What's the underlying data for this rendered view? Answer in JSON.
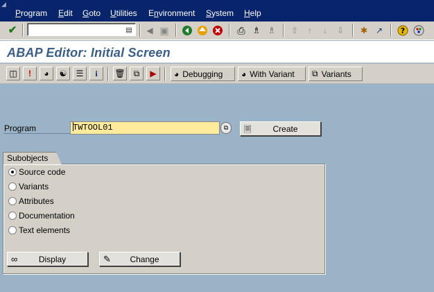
{
  "menu": {
    "items": [
      {
        "label": "Program",
        "underline": "P",
        "rest": "rogram"
      },
      {
        "label": "Edit",
        "underline": "E",
        "rest": "dit"
      },
      {
        "label": "Goto",
        "underline": "G",
        "rest": "oto"
      },
      {
        "label": "Utilities",
        "underline": "U",
        "rest": "tilities"
      },
      {
        "label": "Environment",
        "pre": "E",
        "underline": "n",
        "rest": "vironment"
      },
      {
        "label": "System",
        "underline": "S",
        "rest": "ystem"
      },
      {
        "label": "Help",
        "underline": "H",
        "rest": "elp"
      }
    ]
  },
  "toolbar": {
    "command_value": "",
    "icons": [
      "enter-icon",
      "back-icon",
      "save-icon",
      "back-nav-icon",
      "exit-icon",
      "cancel-icon",
      "print-icon",
      "find-icon",
      "find-next-icon",
      "first-page-icon",
      "previous-page-icon",
      "next-page-icon",
      "last-page-icon",
      "new-session-icon",
      "shortcut-icon",
      "help-icon",
      "layout-menu-icon"
    ]
  },
  "title": "ABAP Editor: Initial Screen",
  "app_toolbar": {
    "debugging_label": "Debugging",
    "with_variant_label": "With Variant",
    "variants_label": "Variants"
  },
  "program": {
    "label": "Program",
    "value": "TWTOOL01",
    "create_label": "Create"
  },
  "subobjects": {
    "title": "Subobjects",
    "options": [
      "Source code",
      "Variants",
      "Attributes",
      "Documentation",
      "Text elements"
    ],
    "selected": "Source code"
  },
  "actions": {
    "display_label": "Display",
    "change_label": "Change"
  },
  "colors": {
    "menubar": "#08246b",
    "title": "#3b5e87",
    "background": "#9bb3c6",
    "input": "#ffeb9c"
  }
}
